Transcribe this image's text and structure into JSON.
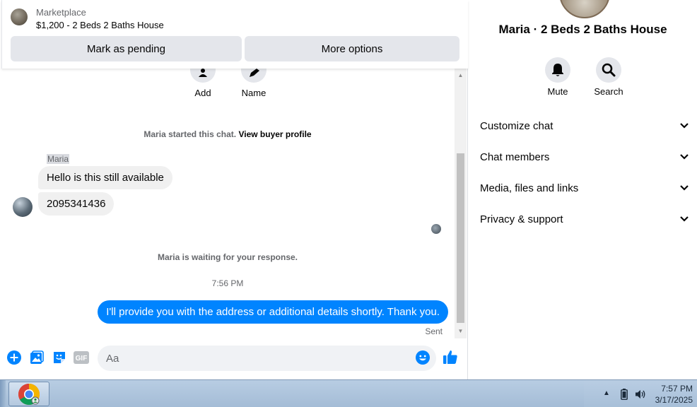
{
  "marketplace": {
    "label": "Marketplace",
    "listing_title": "$1,200 - 2 Beds 2 Baths House",
    "mark_pending_label": "Mark as pending",
    "more_options_label": "More options"
  },
  "chat_actions": {
    "add_label": "Add",
    "name_label": "Name"
  },
  "messages": {
    "started_text": "Maria started this chat.",
    "buyer_profile_link": "View buyer profile",
    "sender_name": "Maria",
    "incoming": [
      "Hello is this still available",
      "2095341436"
    ],
    "waiting_text": "Maria is waiting for your response.",
    "timestamp": "7:56 PM",
    "outgoing": "I'll provide you with the address or additional details shortly. Thank you.",
    "status": "Sent"
  },
  "composer": {
    "placeholder": "Aa",
    "gif_label": "GIF"
  },
  "info": {
    "title": "Maria · 2 Beds 2 Baths House",
    "mute_label": "Mute",
    "search_label": "Search",
    "sections": [
      "Customize chat",
      "Chat members",
      "Media, files and links",
      "Privacy & support"
    ]
  },
  "taskbar": {
    "time": "7:57 PM",
    "date": "3/17/2025"
  },
  "colors": {
    "accent": "#0084ff",
    "bubble_in": "#f0f0f0",
    "button_bg": "#e4e6eb"
  }
}
